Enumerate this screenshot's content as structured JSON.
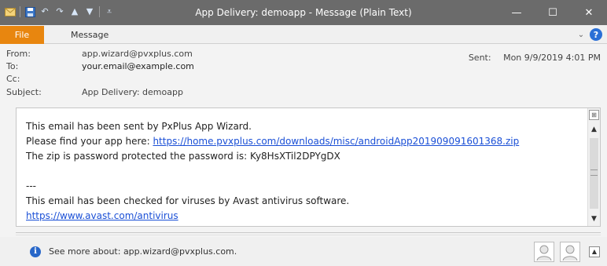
{
  "window": {
    "title": "App Delivery: demoapp  -  Message (Plain Text)",
    "minimize_glyph": "—",
    "maximize_glyph": "☐",
    "close_glyph": "✕"
  },
  "quick_access": {
    "icons": [
      "envelope-icon",
      "save-icon",
      "undo-icon",
      "redo-icon",
      "up-arrow-icon",
      "down-arrow-icon",
      "customize-icon"
    ]
  },
  "ribbon": {
    "file_tab": "File",
    "message_tab": "Message",
    "help_glyph": "?",
    "collapse_glyph": "⌄"
  },
  "headers": {
    "from_label": "From:",
    "from_value": "app.wizard@pvxplus.com",
    "to_label": "To:",
    "to_value": "your.email@example.com",
    "cc_label": "Cc:",
    "cc_value": "",
    "subject_label": "Subject:",
    "subject_value": "App Delivery: demoapp",
    "sent_label": "Sent:",
    "sent_value": "Mon 9/9/2019 4:01 PM"
  },
  "body": {
    "line1": "This email has been sent by PxPlus App Wizard.",
    "line2_prefix": "Please find your app here: ",
    "line2_link": "https://home.pvxplus.com/downloads/misc/androidApp201909091601368.zip",
    "line3": "The zip is password protected the password is:  Ky8HsXTil2DPYgDX",
    "separator": "---",
    "line5": "This email has been checked for viruses by Avast antivirus software.",
    "line6_link": "https://www.avast.com/antivirus"
  },
  "people_pane": {
    "see_more": "See more about: app.wizard@pvxplus.com."
  },
  "colors": {
    "titlebar": "#6b6b6b",
    "file_tab": "#e8860f",
    "link": "#1a4fd6",
    "info_icon": "#2867c9"
  }
}
